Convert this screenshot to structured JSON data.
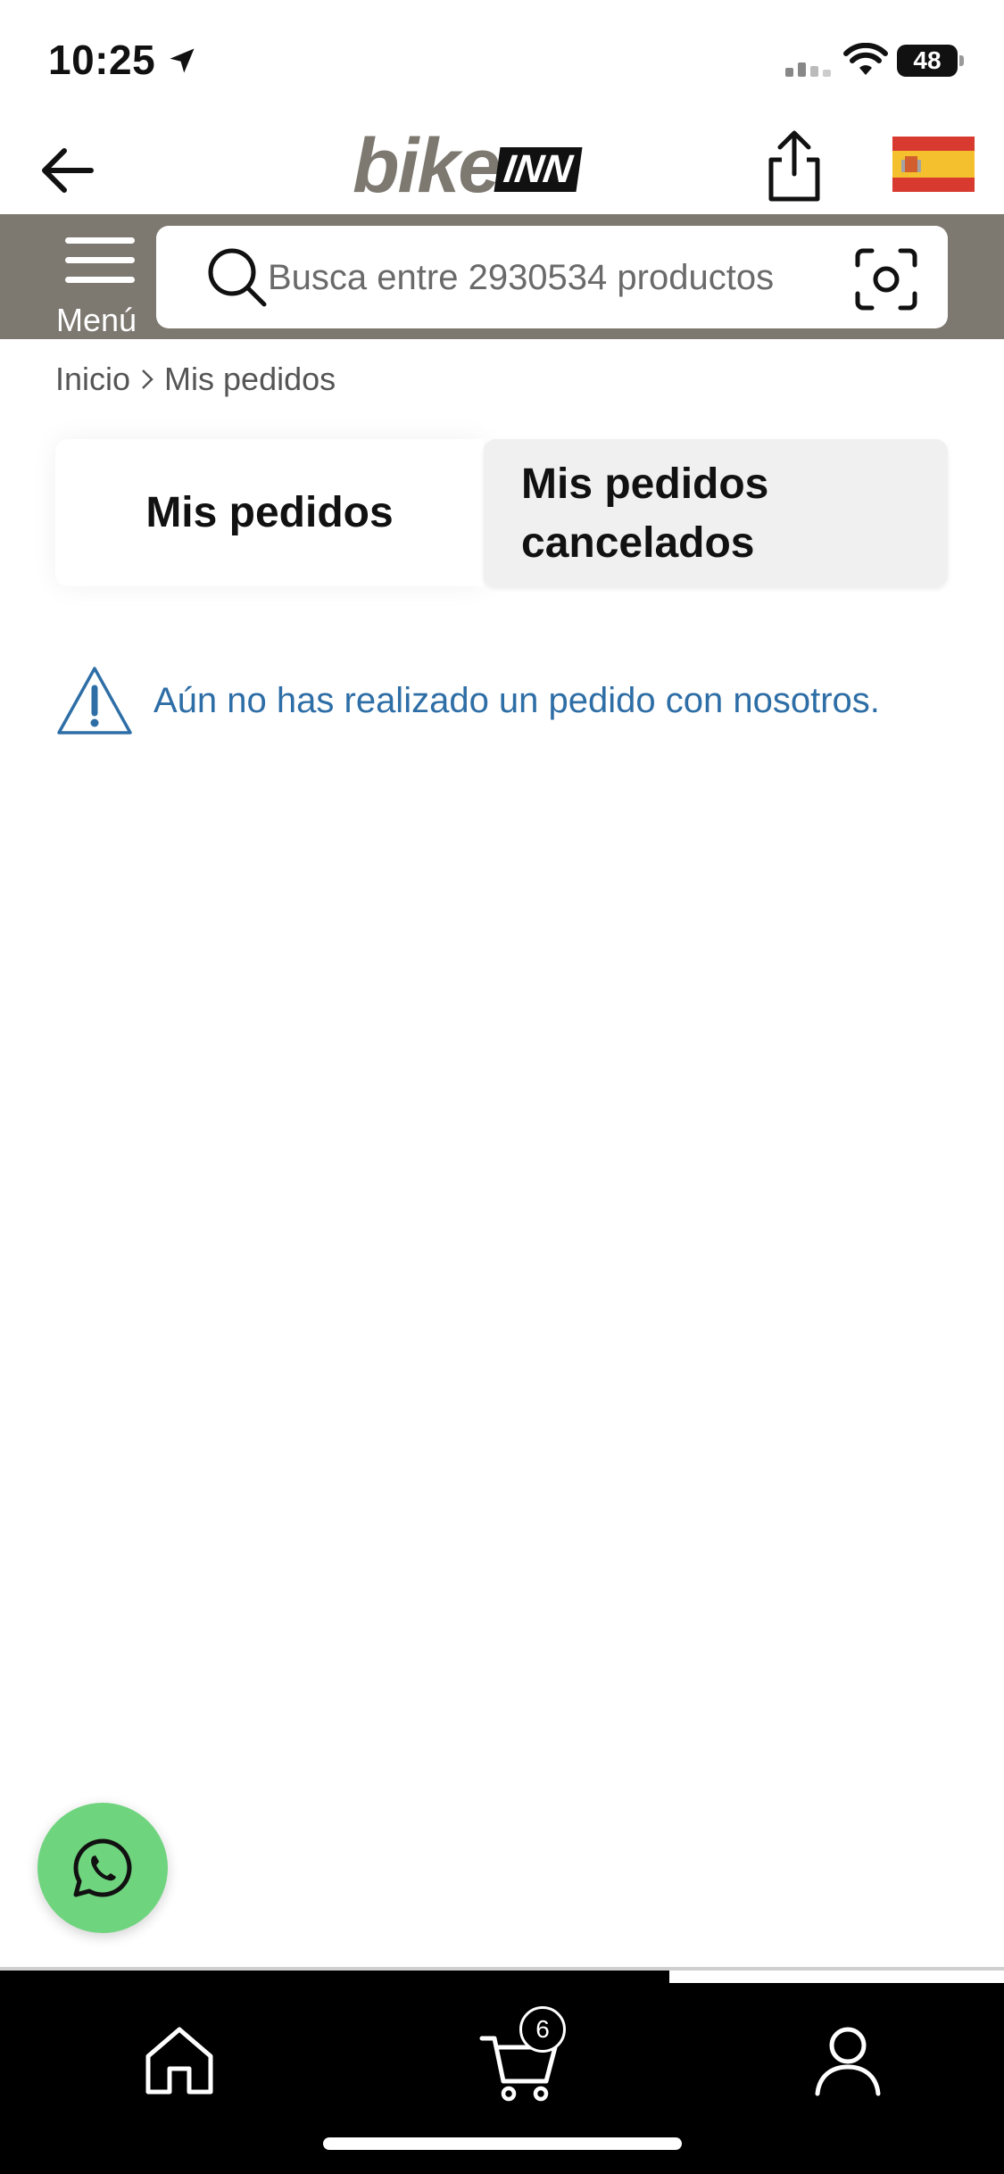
{
  "status_bar": {
    "time": "10:25",
    "battery": "48"
  },
  "header": {
    "logo_bike": "bike",
    "logo_inn": "INN",
    "back_icon": "arrow-left-icon",
    "share_icon": "share-icon",
    "flag_icon": "spain-flag-icon"
  },
  "search": {
    "menu_label": "Menú",
    "placeholder": "Busca entre 2930534 productos"
  },
  "breadcrumb": {
    "home": "Inicio",
    "current": "Mis pedidos"
  },
  "tabs": {
    "active_label": "Mis pedidos",
    "inactive_label_line1": "Mis pedidos",
    "inactive_label_line2": "cancelados"
  },
  "notice": {
    "text": "Aún no has realizado un pedido con nosotros."
  },
  "bottom_nav": {
    "cart_count": "6"
  },
  "colors": {
    "brand_gray": "#7d7870",
    "link_blue": "#2e6ea6",
    "whatsapp_green": "#6fd47e"
  }
}
